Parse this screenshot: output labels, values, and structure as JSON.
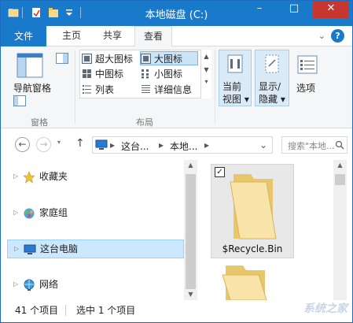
{
  "window": {
    "title": "本地磁盘 (C:)",
    "controls": {
      "minimize": "–",
      "maximize": "□",
      "close": "✕"
    }
  },
  "ribbon_tabs": {
    "file": "文件",
    "tabs": [
      "主页",
      "共享",
      "查看"
    ],
    "active": "查看",
    "collapse": "⌄",
    "help": "?"
  },
  "ribbon": {
    "panes_group": {
      "nav_pane": "导航窗格",
      "label": "窗格"
    },
    "layout_group": {
      "items": [
        "超大图标",
        "大图标",
        "中图标",
        "小图标",
        "列表",
        "详细信息"
      ],
      "selected": "大图标",
      "label": "布局"
    },
    "current_view": {
      "line1": "当前",
      "line2": "视图 ▾"
    },
    "show_hide": {
      "line1": "显示/",
      "line2": "隐藏 ▾"
    },
    "options": "选项"
  },
  "address": {
    "back": "←",
    "forward": "→",
    "up": "↑",
    "separator": "▸",
    "segments": [
      "这台...",
      "本地..."
    ],
    "dropdown": "⌄",
    "refresh": "↻",
    "search_placeholder": "搜索\"本地..."
  },
  "nav_pane": {
    "items": [
      {
        "label": "收藏夹",
        "icon": "star-icon"
      },
      {
        "label": "家庭组",
        "icon": "homegroup-icon"
      },
      {
        "label": "这台电脑",
        "icon": "computer-icon",
        "selected": true
      },
      {
        "label": "网络",
        "icon": "network-icon"
      }
    ],
    "chevron": "▷"
  },
  "content": {
    "items": [
      {
        "name": "$Recycle.Bin",
        "checked": true
      }
    ],
    "check_mark": "✓"
  },
  "status_bar": {
    "item_count": "41 个项目",
    "selected": "选中 1 个项目",
    "watermark": "系统之家"
  },
  "colors": {
    "title_bar": "#1979ca",
    "close_button": "#c7362f",
    "selection": "#cce8ff",
    "folder": "#f0d68a"
  }
}
